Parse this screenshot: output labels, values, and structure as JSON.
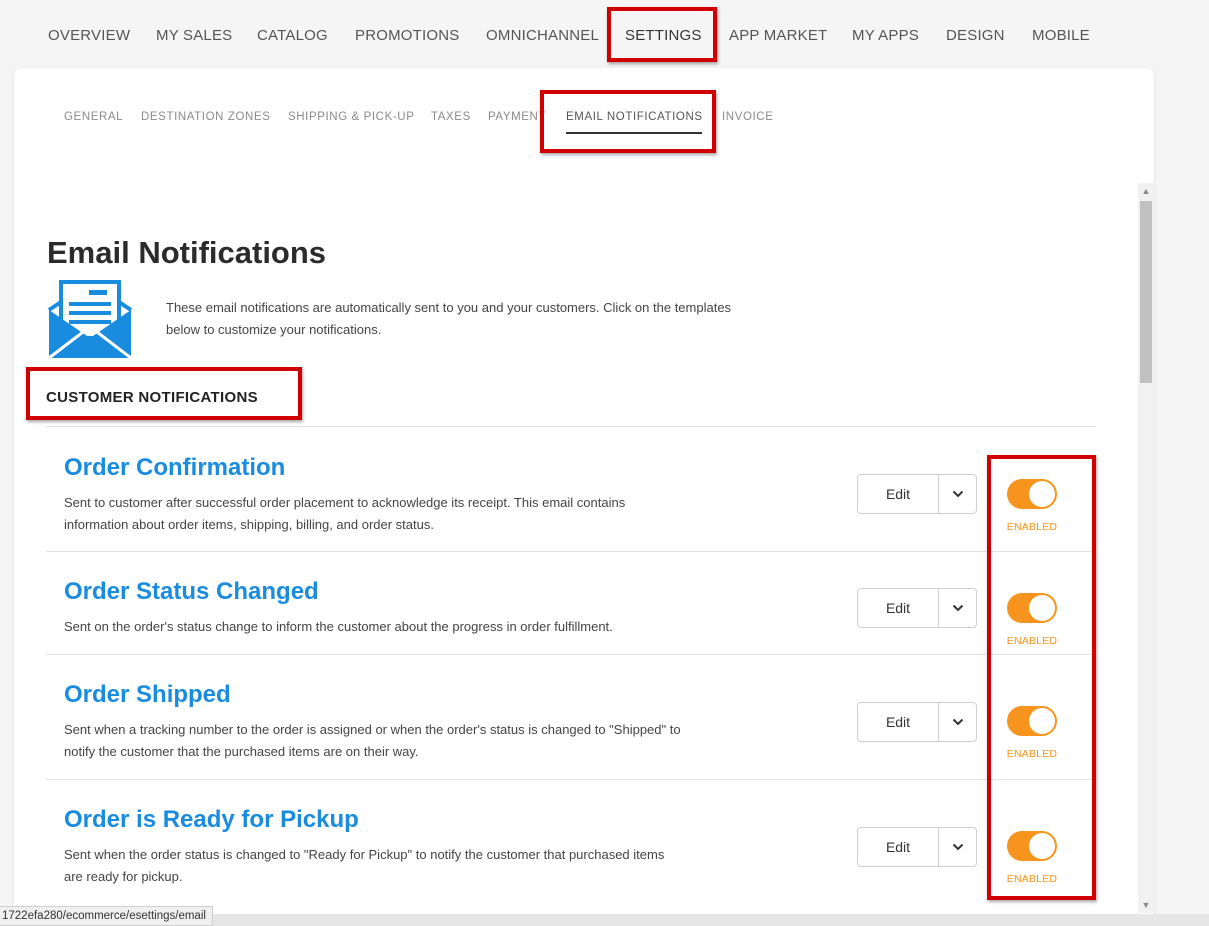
{
  "top_nav": {
    "items": [
      {
        "label": "OVERVIEW"
      },
      {
        "label": "MY SALES"
      },
      {
        "label": "CATALOG"
      },
      {
        "label": "PROMOTIONS"
      },
      {
        "label": "OMNICHANNEL"
      },
      {
        "label": "SETTINGS",
        "active": true
      },
      {
        "label": "APP MARKET"
      },
      {
        "label": "MY APPS"
      },
      {
        "label": "DESIGN"
      },
      {
        "label": "MOBILE"
      }
    ]
  },
  "sub_tabs": {
    "items": [
      {
        "label": "GENERAL"
      },
      {
        "label": "DESTINATION ZONES"
      },
      {
        "label": "SHIPPING & PICK-UP"
      },
      {
        "label": "TAXES"
      },
      {
        "label": "PAYMENT"
      },
      {
        "label": "EMAIL NOTIFICATIONS",
        "active": true
      },
      {
        "label": "INVOICE"
      }
    ]
  },
  "page": {
    "title": "Email Notifications",
    "icon": "envelope-icon",
    "intro": "These email notifications are automatically sent to you and your customers. Click on the templates below to customize your notifications."
  },
  "section": {
    "title": "CUSTOMER NOTIFICATIONS"
  },
  "notifications": [
    {
      "title": "Order Confirmation",
      "description": "Sent to customer after successful order placement to acknowledge its receipt. This email contains information about order items, shipping, billing, and order status.",
      "edit_label": "Edit",
      "status_label": "ENABLED",
      "enabled": true
    },
    {
      "title": "Order Status Changed",
      "description": "Sent on the order's status change to inform the customer about the progress in order fulfillment.",
      "edit_label": "Edit",
      "status_label": "ENABLED",
      "enabled": true
    },
    {
      "title": "Order Shipped",
      "description": "Sent when a tracking number to the order is assigned or when the order's status is changed to \"Shipped\" to notify the customer that the purchased items are on their way.",
      "edit_label": "Edit",
      "status_label": "ENABLED",
      "enabled": true
    },
    {
      "title": "Order is Ready for Pickup",
      "description": "Sent when the order status is changed to \"Ready for Pickup\" to notify the customer that purchased items are ready for pickup.",
      "edit_label": "Edit",
      "status_label": "ENABLED",
      "enabled": true
    }
  ],
  "status_bar": {
    "url": "1722efa280/ecommerce/esettings/email"
  },
  "colors": {
    "accent_blue": "#1a8ce0",
    "toggle_orange": "#f7941d",
    "annotation_red": "#d00000"
  }
}
